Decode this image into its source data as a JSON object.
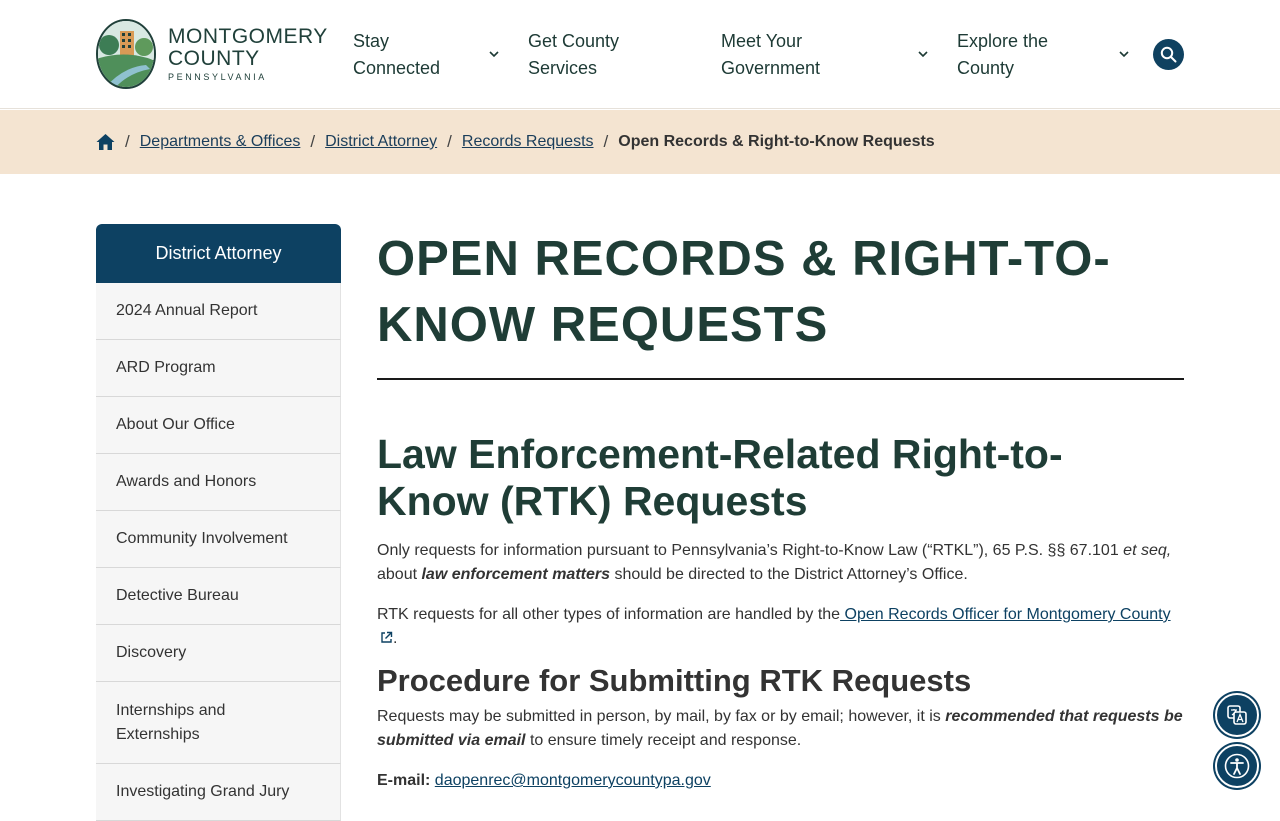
{
  "logo": {
    "line1": "MONTGOMERY",
    "line2": "COUNTY",
    "line3": "PENNSYLVANIA"
  },
  "nav": {
    "items": [
      {
        "line1": "Stay",
        "line2": "Connected"
      },
      {
        "line1": "Get County",
        "line2": "Services"
      },
      {
        "line1": "Meet Your",
        "line2": "Government"
      },
      {
        "line1": "Explore the",
        "line2": "County"
      }
    ],
    "search_icon": "search-icon"
  },
  "breadcrumb": {
    "home_icon": "home-icon",
    "links": [
      "Departments & Offices",
      "District Attorney",
      "Records Requests"
    ],
    "current": "Open Records & Right-to-Know Requests"
  },
  "sidebar": {
    "title": "District Attorney",
    "items": [
      "2024 Annual Report",
      "ARD Program",
      "About Our Office",
      "Awards and Honors",
      "Community Involvement",
      "Detective Bureau",
      "Discovery",
      "Internships and Externships",
      "Investigating Grand Jury"
    ]
  },
  "main": {
    "title_line1": "OPEN RECORDS & RIGHT-TO-",
    "title_line2": "KNOW REQUESTS",
    "h2_line1": "Law Enforcement-Related Right-to-",
    "h2_line2": "Know (RTK) Requests",
    "p1_a": "Only requests for information pursuant to Pennsylvania’s Right-to-Know Law (“RTKL”), 65 P.S. §§ 67.101",
    "p1_b": "et seq,",
    "p1_c": " about ",
    "p1_d": "law enforcement matters",
    "p1_e": " should be directed to the District Attorney’s Office.",
    "p2_a": "RTK requests for all other types of information are handled by the",
    "p2_link": " Open Records Officer for Montgomery County",
    "p2_end": ".",
    "h3": "Procedure for Submitting RTK Requests",
    "p3_a": "Requests may be submitted in person, by mail, by fax or by email; however, it is ",
    "p3_b": "recommended that requests be submitted via email",
    "p3_c": " to ensure timely receipt and response.",
    "email_label": "E-mail:",
    "email": "daopenrec@montgomerycountypa.gov"
  },
  "floating": {
    "translate_icon": "translate-icon",
    "accessibility_icon": "accessibility-icon"
  },
  "colors": {
    "navy": "#0d4162",
    "heading_green": "#1f3d36",
    "crumb_bg": "#f4e4d1"
  }
}
